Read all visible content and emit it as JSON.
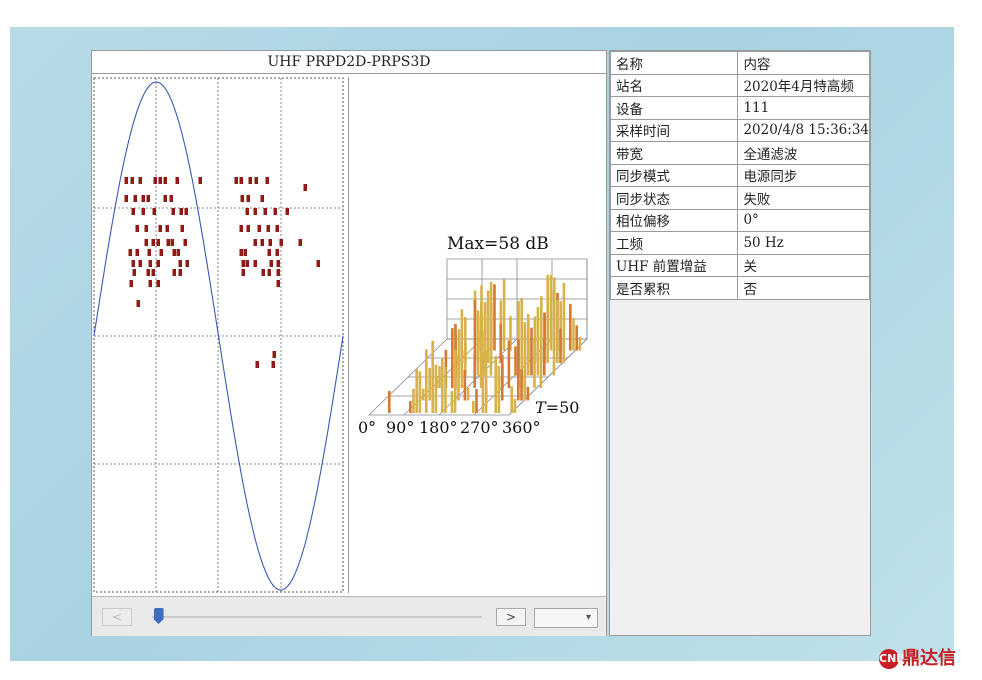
{
  "window": {
    "title": "UHF PRPD2D-PRPS3D"
  },
  "prps3d": {
    "max_label": "Max=58 dB",
    "t_label_italic": "T",
    "t_label_value": "=50",
    "phase_ticks": [
      "0°",
      "90°",
      "180°",
      "270°",
      "360°"
    ]
  },
  "controls": {
    "prev_label": "<",
    "next_label": ">",
    "slider_position": 0.02,
    "dropdown_value": ""
  },
  "info_table": {
    "header": {
      "key": "名称",
      "value": "内容"
    },
    "rows": [
      {
        "key": "站名",
        "value": "2020年4月特高频"
      },
      {
        "key": "设备",
        "value": "111"
      },
      {
        "key": "采样时间",
        "value": "2020/4/8 15:36:34"
      },
      {
        "key": "带宽",
        "value": "全通滤波"
      },
      {
        "key": "同步模式",
        "value": "电源同步"
      },
      {
        "key": "同步状态",
        "value": "失败"
      },
      {
        "key": "相位偏移",
        "value": "0°"
      },
      {
        "key": "工频",
        "value": "50 Hz"
      },
      {
        "key": "UHF 前置增益",
        "value": "关"
      },
      {
        "key": "是否累积",
        "value": "否"
      }
    ]
  },
  "brand": {
    "mark": "CNIS",
    "text": "鼎达信"
  },
  "colors": {
    "sine": "#3c59b0",
    "dots": "#8f1b14",
    "bars": "#d7b14a",
    "bars_accent": "#d47a33",
    "brand": "#c81e24"
  }
}
